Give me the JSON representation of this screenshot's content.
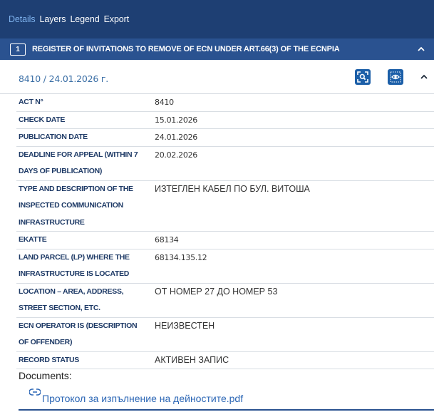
{
  "tabs": [
    {
      "label": "Details",
      "active": true
    },
    {
      "label": "Layers",
      "active": false
    },
    {
      "label": "Legend",
      "active": false
    },
    {
      "label": "Export",
      "active": false
    }
  ],
  "section": {
    "number": "1",
    "title": "REGISTER OF INVITATIONS TO REMOVE OF ECN UNDER ART.66(3) OF THE ECNPIA"
  },
  "record": {
    "title": "8410 / 24.01.2026 г."
  },
  "fields": [
    {
      "label_lines": [
        "ACT N°"
      ],
      "value": "8410",
      "cyr": false
    },
    {
      "label_lines": [
        "CHECK DATE"
      ],
      "value": "15.01.2026",
      "cyr": false
    },
    {
      "label_lines": [
        "PUBLICATION DATE"
      ],
      "value": "24.01.2026",
      "cyr": false
    },
    {
      "label_lines": [
        "DEADLINE FOR APPEAL (WITHIN 7",
        "DAYS OF PUBLICATION)"
      ],
      "value": "20.02.2026",
      "cyr": false
    },
    {
      "label_lines": [
        "TYPE AND DESCRIPTION OF THE",
        "INSPECTED COMMUNICATION",
        "INFRASTRUCTURE"
      ],
      "value": "ИЗТЕГЛЕН КАБЕЛ ПО БУЛ. ВИТОША",
      "cyr": true
    },
    {
      "label_lines": [
        "EKATTE"
      ],
      "value": "68134",
      "cyr": false
    },
    {
      "label_lines": [
        "LAND PARCEL (LP) WHERE THE",
        "INFRASTRUCTURE IS LOCATED"
      ],
      "value": "68134.135.12",
      "cyr": false
    },
    {
      "label_lines": [
        "LOCATION – AREA, ADDRESS,",
        "STREET SECTION, ETC."
      ],
      "value": "ОТ НОМЕР 27 ДО НОМЕР 53",
      "cyr": true
    },
    {
      "label_lines": [
        "ECN OPERATOR IS (DESCRIPTION",
        "OF OFFENDER)"
      ],
      "value": "НЕИЗВЕСТЕН",
      "cyr": true
    },
    {
      "label_lines": [
        "RECORD STATUS"
      ],
      "value": "АКТИВЕН ЗАПИС",
      "cyr": true
    }
  ],
  "documents": {
    "heading": "Documents:",
    "items": [
      {
        "label": "Протокол за изпълнение на дейностите.pdf",
        "icon": "link-icon"
      }
    ]
  },
  "colors": {
    "tabbar_bg": "#1e3f73",
    "section_bg": "#2a5290",
    "accent": "#1c5fa8",
    "label_text": "#1e3a66",
    "link": "#2b66b5"
  }
}
